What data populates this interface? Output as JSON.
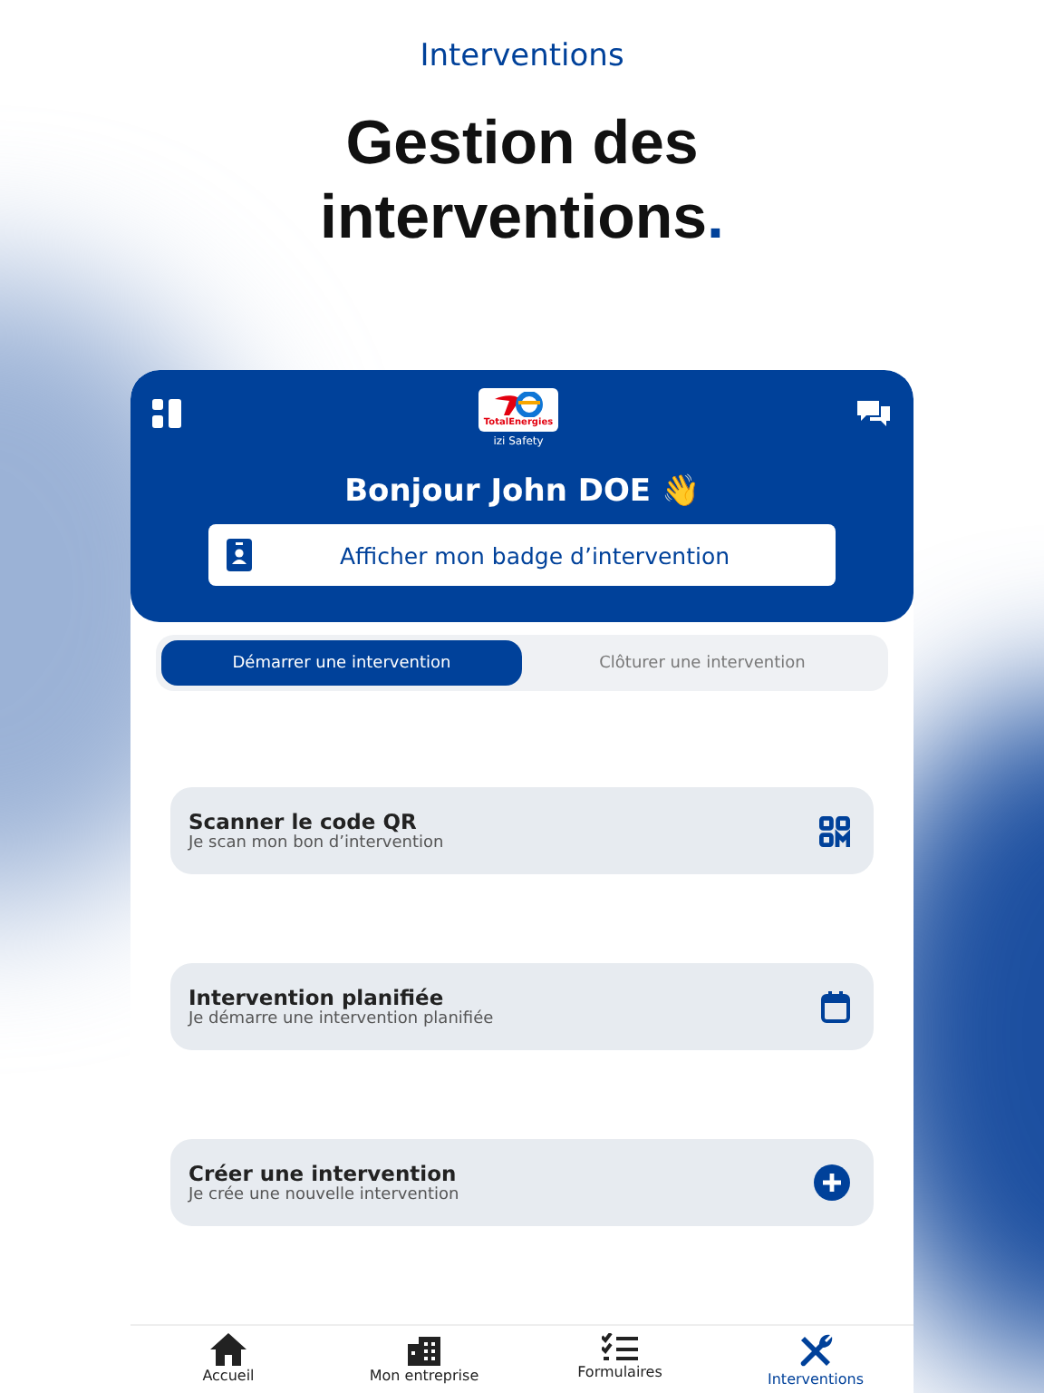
{
  "eyebrow": "Interventions",
  "headline": {
    "text": "Gestion des interventions",
    "accent": "."
  },
  "app": {
    "logo": {
      "brand": "TotalEnergies",
      "product": "izi Safety"
    },
    "greeting": "Bonjour John DOE 👋",
    "badge_button": "Afficher mon badge d’intervention",
    "tabs": [
      {
        "label": "Démarrer une intervention",
        "selected": true
      },
      {
        "label": "Clôturer une intervention",
        "selected": false
      }
    ],
    "actions": [
      {
        "title": "Scanner le code QR",
        "subtitle": "Je scan mon bon d’intervention",
        "kind": "qr"
      },
      {
        "title": "Intervention planifiée",
        "subtitle": "Je démarre une intervention planifiée",
        "kind": "calendar"
      },
      {
        "title": "Créer une intervention",
        "subtitle": "Je crée une nouvelle intervention",
        "kind": "add"
      }
    ],
    "nav": [
      {
        "label": "Accueil",
        "kind": "home",
        "selected": false
      },
      {
        "label": "Mon entreprise",
        "kind": "building",
        "selected": false
      },
      {
        "label": "Formulaires",
        "kind": "checklist",
        "selected": false
      },
      {
        "label": "Interventions",
        "kind": "tools",
        "selected": true
      }
    ]
  }
}
